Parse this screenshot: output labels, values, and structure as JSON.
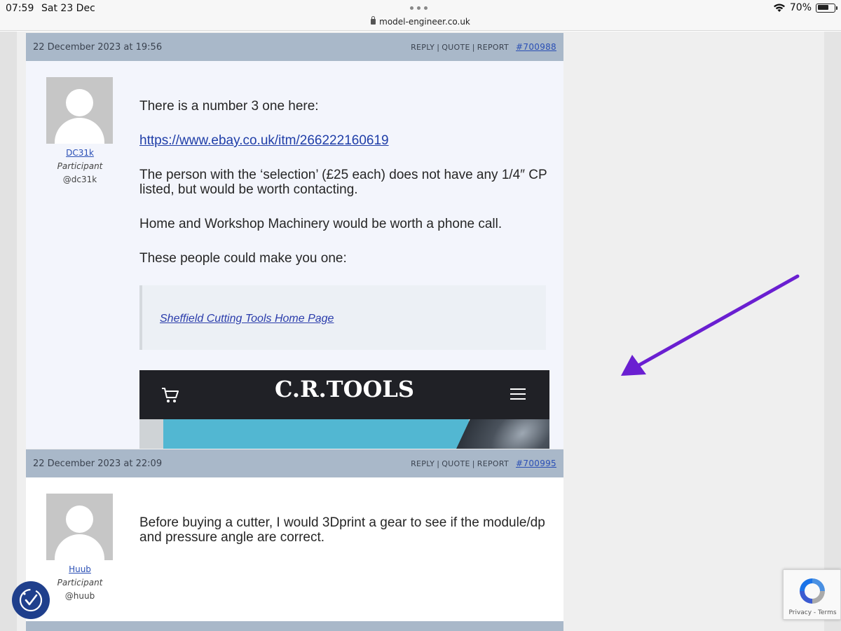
{
  "status_bar": {
    "time": "07:59",
    "date": "Sat 23 Dec",
    "url": "model-engineer.co.uk",
    "battery": "70%",
    "battery_level": 0.7
  },
  "posts": [
    {
      "date": "22 December 2023 at 19:56",
      "actions": {
        "reply": "REPLY",
        "quote": "QUOTE",
        "report": "REPORT"
      },
      "post_number": "#700988",
      "author": {
        "name": "DC31k",
        "role": "Participant",
        "handle": "@dc31k"
      },
      "paragraphs": [
        "There is a number 3 one here:",
        "The person with the ‘selection’ (£25 each) does not have any 1/4″ CP listed, but would be worth contacting.",
        "Home and Workshop Machinery would be worth a phone call.",
        "These people could make you one:"
      ],
      "link": "https://www.ebay.co.uk/itm/266222160619",
      "embed_link": "Sheffield Cutting Tools Home Page",
      "embed_banner_logo": "C.R.TOOLS"
    },
    {
      "date": "22 December 2023 at 22:09",
      "actions": {
        "reply": "REPLY",
        "quote": "QUOTE",
        "report": "REPORT"
      },
      "post_number": "#700995",
      "author": {
        "name": "Huub",
        "role": "Participant",
        "handle": "@huub"
      },
      "paragraphs": [
        "Before buying a cutter, I would 3Dprint a gear to see if the module/dp  and pressure angle are correct."
      ]
    }
  ],
  "recaptcha": {
    "label": "Privacy - Terms"
  },
  "colors": {
    "post_header": "#a9b8c9",
    "post_body_1": "#f3f5fc",
    "post_body_2": "#ffffff",
    "link": "#2a4fb5",
    "arrow": "#6a1fd1",
    "badge": "#1f3f8c"
  },
  "icons": [
    "lock-icon",
    "wifi-icon",
    "battery-icon",
    "cart-icon",
    "menu-icon",
    "recaptcha-icon",
    "accessibility-icon",
    "arrow-annotation"
  ]
}
